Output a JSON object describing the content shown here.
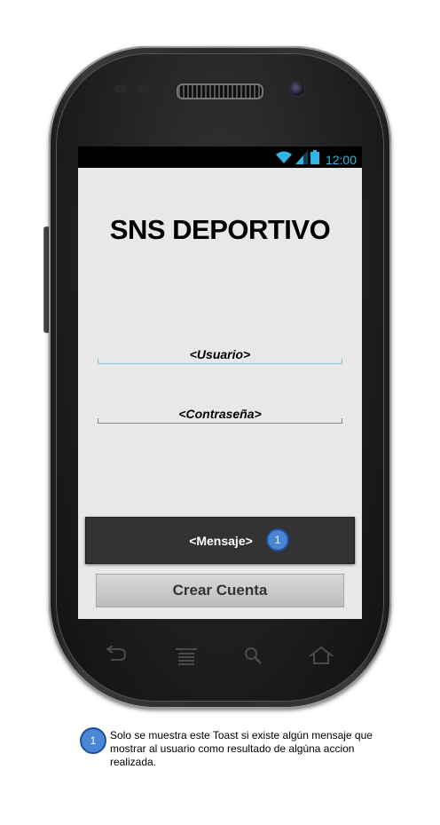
{
  "status_bar": {
    "time": "12:00"
  },
  "app": {
    "title": "SNS DEPORTIVO",
    "username_placeholder": "<Usuario>",
    "password_placeholder": "<Contraseña>",
    "create_account_label": "Crear Cuenta"
  },
  "toast": {
    "message": "<Mensaje>",
    "badge_number": "1"
  },
  "annotation": {
    "badge_number": "1",
    "text": "Solo se muestra este Toast si existe algún mensaje que mostrar al usuario como resultado de algúna accion realizada."
  },
  "colors": {
    "status_accent": "#33b5e5",
    "screen_bg": "#e8e8e8",
    "toast_bg": "#333333",
    "badge_fill": "#4a86d4",
    "focused_field_line": "#7fc4e8"
  },
  "icons": {
    "status": [
      "wifi-icon",
      "signal-icon",
      "battery-icon"
    ],
    "nav_keys": [
      "back-icon",
      "menu-icon",
      "search-icon",
      "home-icon"
    ]
  }
}
